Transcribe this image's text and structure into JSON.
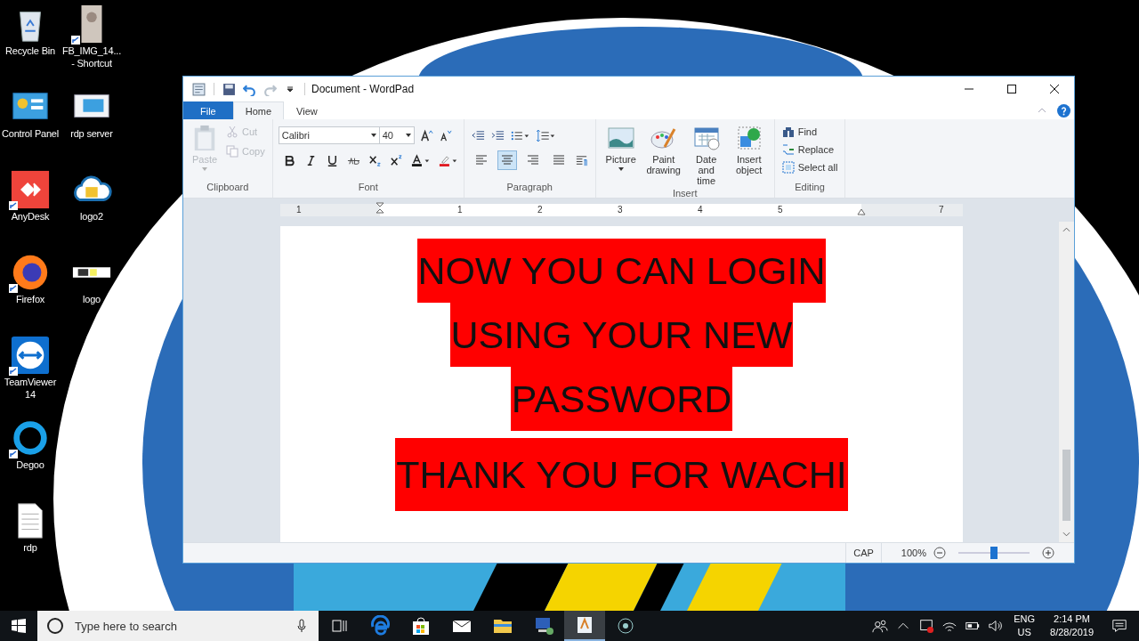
{
  "desktop": {
    "columns": [
      [
        {
          "label": "Recycle Bin",
          "kind": "recycle",
          "shortcut": false
        },
        {
          "label": "Control Panel",
          "kind": "control-panel",
          "shortcut": false
        },
        {
          "label": "AnyDesk",
          "kind": "anydesk",
          "shortcut": true
        },
        {
          "label": "Firefox",
          "kind": "firefox",
          "shortcut": true
        },
        {
          "label": "TeamViewer 14",
          "kind": "teamviewer",
          "shortcut": true
        },
        {
          "label": "Degoo",
          "kind": "degoo",
          "shortcut": true
        },
        {
          "label": "rdp",
          "kind": "document",
          "shortcut": false
        }
      ],
      [
        {
          "label": "FB_IMG_14... - Shortcut",
          "kind": "photo",
          "shortcut": true
        },
        {
          "label": "rdp server",
          "kind": "rdp-server",
          "shortcut": false
        },
        {
          "label": "logo2",
          "kind": "cloud",
          "shortcut": false
        },
        {
          "label": "logo",
          "kind": "strip",
          "shortcut": false
        }
      ]
    ]
  },
  "window": {
    "title": "Document - WordPad",
    "tabs": [
      {
        "label": "File",
        "kind": "file",
        "selected": false
      },
      {
        "label": "Home",
        "kind": "tab",
        "selected": true
      },
      {
        "label": "View",
        "kind": "tab",
        "selected": false
      }
    ],
    "clipboard": {
      "label": "Clipboard",
      "paste": {
        "label": "Paste",
        "disabled": true
      },
      "items": [
        {
          "label": "Cut",
          "kind": "cut",
          "disabled": true
        },
        {
          "label": "Copy",
          "kind": "copy",
          "disabled": true
        }
      ]
    },
    "font": {
      "label": "Font",
      "family": "Calibri",
      "size": "40"
    },
    "paragraph": {
      "label": "Paragraph",
      "align": [
        {
          "kind": "left",
          "selected": false
        },
        {
          "kind": "center",
          "selected": true
        },
        {
          "kind": "right",
          "selected": false
        },
        {
          "kind": "justify",
          "selected": false
        }
      ]
    },
    "insert": {
      "label": "Insert",
      "items": [
        {
          "label": "Picture",
          "kind": "picture",
          "dropdown": true
        },
        {
          "label": "Paint drawing",
          "kind": "paint",
          "dropdown": false
        },
        {
          "label": "Date and time",
          "kind": "calendar",
          "dropdown": false
        },
        {
          "label": "Insert object",
          "kind": "object",
          "dropdown": false
        }
      ]
    },
    "editing": {
      "label": "Editing",
      "items": [
        {
          "label": "Find",
          "kind": "find"
        },
        {
          "label": "Replace",
          "kind": "replace"
        },
        {
          "label": "Select all",
          "kind": "select"
        }
      ]
    },
    "ruler": {
      "left_labels": [
        "1"
      ],
      "labels": [
        "1",
        "2",
        "3",
        "4",
        "5"
      ],
      "right_labels": [
        "7"
      ]
    },
    "document": {
      "lines": [
        "NOW YOU CAN LOGIN",
        "USING YOUR NEW",
        "PASSWORD",
        "THANK YOU FOR WACHI"
      ]
    },
    "status_bar": {
      "caps": "CAP",
      "zoom": "100%",
      "zoom_level": {
        "level": 0.5
      }
    }
  },
  "taskbar": {
    "search": {
      "placeholder": "Type here to search"
    },
    "apps": [
      {
        "kind": "taskview",
        "selected": false
      },
      {
        "kind": "edge",
        "selected": false
      },
      {
        "kind": "store",
        "selected": false
      },
      {
        "kind": "mail",
        "selected": false
      },
      {
        "kind": "folder",
        "selected": false
      },
      {
        "kind": "remote",
        "selected": false
      },
      {
        "kind": "wordpad",
        "selected": true
      },
      {
        "kind": "ring",
        "selected": false
      }
    ],
    "language": [
      "ENG",
      "US"
    ],
    "time": "2:14 PM",
    "date": "8/28/2019"
  }
}
